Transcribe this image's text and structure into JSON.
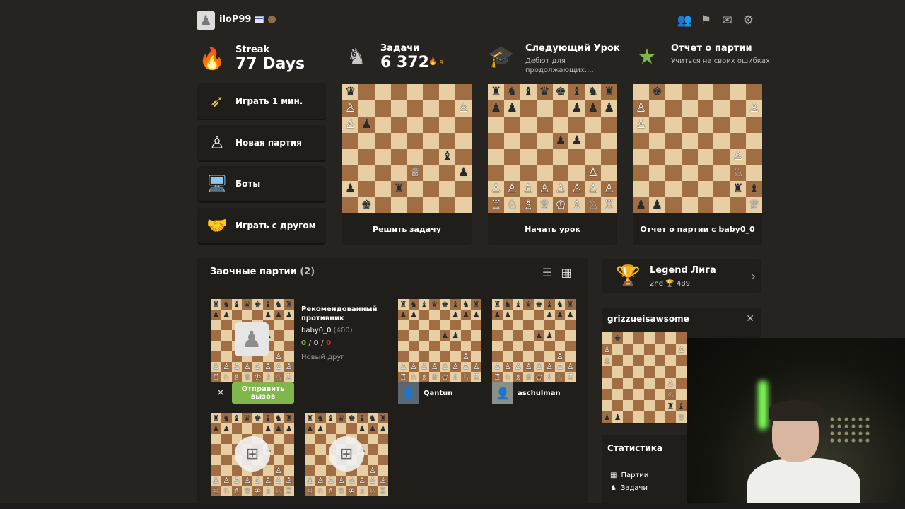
{
  "header": {
    "username": "iloP99",
    "icons": [
      "friends-icon",
      "hint-icon",
      "mail-icon",
      "settings-icon"
    ]
  },
  "stats": {
    "streak": {
      "label": "Streak",
      "value": "77 Days"
    },
    "puzzles": {
      "label": "Задачи",
      "value": "6 372",
      "badge": "6",
      "flame": "9"
    },
    "lesson": {
      "label": "Следующий Урок",
      "sub": "Дебют для продолжающих:..."
    },
    "review": {
      "label": "Отчет о партии",
      "sub": "Учиться на своих ошибках"
    }
  },
  "actions": [
    {
      "label": "Играть 1 мин.",
      "icon": "bullet-icon"
    },
    {
      "label": "Новая партия",
      "icon": "pawn-hand-icon"
    },
    {
      "label": "Боты",
      "icon": "computer-icon"
    },
    {
      "label": "Играть с другом",
      "icon": "handshake-icon"
    }
  ],
  "cards": {
    "puzzle": {
      "button": "Решить задачу",
      "rows": [
        "♛.......",
        "♙......♙",
        "♙♟......",
        "........",
        "......♝.",
        "....♕..♟",
        "♟..♜....",
        ".♚......"
      ]
    },
    "lesson": {
      "button": "Начать урок",
      "rows": [
        "♜♞♝♛♚♝♞♜",
        "♟♟...♟♟♟",
        "........",
        "....♟♟..",
        "........",
        "......♙.",
        "♙♙♙♙♙♙♙♙",
        "♖♘♗♕♔♗♘♖"
      ]
    },
    "review": {
      "button": "Отчет о партии с baby0_0",
      "rows": [
        ".♚......",
        "♙......♙",
        "♙.......",
        "........",
        "......♙.",
        "......♘.",
        "......♜♝",
        "♟♟.....♕"
      ]
    }
  },
  "daily": {
    "title": "Заочные партии",
    "count": "(2)",
    "recommended": {
      "title": "Рекомендованный противник",
      "user": "baby0_0",
      "rating": "(400)",
      "score_w": "0",
      "score_d": "0",
      "score_l": "0",
      "note": "Новый друг",
      "challenge": "Отправить вызов"
    },
    "games": [
      {
        "opponent": "Qantun"
      },
      {
        "opponent": "aschulman"
      }
    ]
  },
  "league": {
    "name": "Legend Лига",
    "place": "2nd",
    "trophies": "489"
  },
  "stream": {
    "name": "grizzueisawsome"
  },
  "statistics": {
    "title": "Статистика",
    "items": [
      "Партии",
      "Задачи"
    ]
  },
  "colors": {
    "accent": "#81b64c",
    "bg": "#262421",
    "panel": "#1f1e1b",
    "light_sq": "#e8cfa3",
    "dark_sq": "#a06e42"
  }
}
